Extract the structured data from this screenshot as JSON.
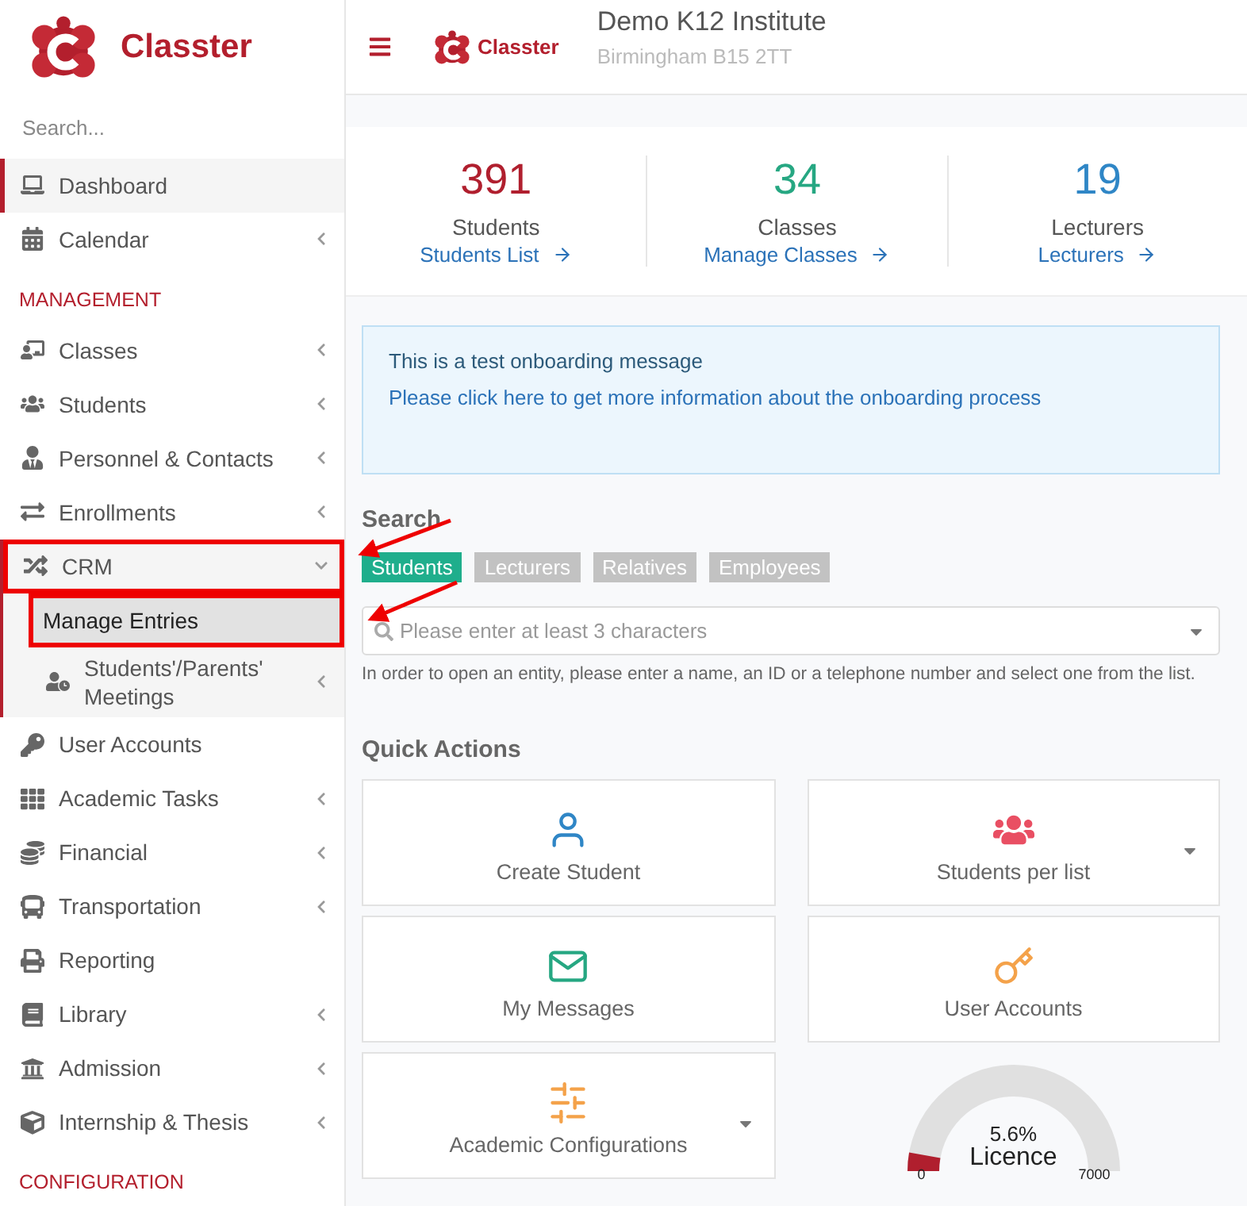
{
  "brand": {
    "name": "Classter"
  },
  "sidebar": {
    "search": {
      "placeholder": "Search..."
    },
    "items": [
      {
        "kind": "item",
        "label": "Dashboard",
        "caret": false,
        "selected": true,
        "highlighted": false
      },
      {
        "kind": "item",
        "label": "Calendar",
        "caret": true,
        "selected": false,
        "highlighted": false
      },
      {
        "kind": "heading",
        "label": "MANAGEMENT"
      },
      {
        "kind": "item",
        "label": "Classes",
        "caret": true,
        "selected": false,
        "highlighted": false
      },
      {
        "kind": "item",
        "label": "Students",
        "caret": true,
        "selected": false,
        "highlighted": false
      },
      {
        "kind": "item",
        "label": "Personnel & Contacts",
        "caret": true,
        "selected": false,
        "highlighted": false
      },
      {
        "kind": "item",
        "label": "Enrollments",
        "caret": true,
        "selected": false,
        "highlighted": false
      },
      {
        "kind": "item",
        "label": "CRM",
        "caret": true,
        "selected": false,
        "highlighted": true,
        "expanded": true,
        "children": [
          {
            "label": "Manage Entries",
            "caret": false,
            "selected": true,
            "highlighted": true
          },
          {
            "label": "Students'/Parents' Meetings",
            "caret": true,
            "selected": false,
            "highlighted": false
          }
        ]
      },
      {
        "kind": "item",
        "label": "User Accounts",
        "caret": false,
        "selected": false,
        "highlighted": false
      },
      {
        "kind": "item",
        "label": "Academic Tasks",
        "caret": true,
        "selected": false,
        "highlighted": false
      },
      {
        "kind": "item",
        "label": "Financial",
        "caret": true,
        "selected": false,
        "highlighted": false
      },
      {
        "kind": "item",
        "label": "Transportation",
        "caret": true,
        "selected": false,
        "highlighted": false
      },
      {
        "kind": "item",
        "label": "Reporting",
        "caret": false,
        "selected": false,
        "highlighted": false
      },
      {
        "kind": "item",
        "label": "Library",
        "caret": true,
        "selected": false,
        "highlighted": false
      },
      {
        "kind": "item",
        "label": "Admission",
        "caret": true,
        "selected": false,
        "highlighted": false
      },
      {
        "kind": "item",
        "label": "Internship & Thesis",
        "caret": true,
        "selected": false,
        "highlighted": false
      },
      {
        "kind": "heading",
        "label": "CONFIGURATION"
      }
    ]
  },
  "header": {
    "brand": "Classter",
    "institute": "Demo K12 Institute",
    "address": "Birmingham B15 2TT"
  },
  "stats": [
    {
      "value": "391",
      "label": "Students",
      "link": "Students List",
      "color": "#b01f2e"
    },
    {
      "value": "34",
      "label": "Classes",
      "link": "Manage Classes",
      "color": "#26a782"
    },
    {
      "value": "19",
      "label": "Lecturers",
      "link": "Lecturers",
      "color": "#2f86c6"
    }
  ],
  "onboarding": {
    "message": "This is a test onboarding message",
    "link": "Please click here to get more information about the onboarding process"
  },
  "search": {
    "title": "Search",
    "tabs": [
      {
        "label": "Students",
        "selected": true
      },
      {
        "label": "Lecturers",
        "selected": false
      },
      {
        "label": "Relatives",
        "selected": false
      },
      {
        "label": "Employees",
        "selected": false
      }
    ],
    "placeholder": "Please enter at least 3 characters",
    "hint": "In order to open an entity, please enter a name, an ID or a telephone number and select one from the list."
  },
  "quick_actions": {
    "title": "Quick Actions",
    "items": [
      {
        "label": "Create Student",
        "dropdown": false
      },
      {
        "label": "Students per list",
        "dropdown": true
      },
      {
        "label": "My Messages",
        "dropdown": false
      },
      {
        "label": "User Accounts",
        "dropdown": false
      },
      {
        "label": "Academic Configurations",
        "dropdown": true
      }
    ]
  },
  "licence": {
    "level": 0.056,
    "percent": "5.6%",
    "label": "Licence",
    "min": "0",
    "max": "7000"
  }
}
